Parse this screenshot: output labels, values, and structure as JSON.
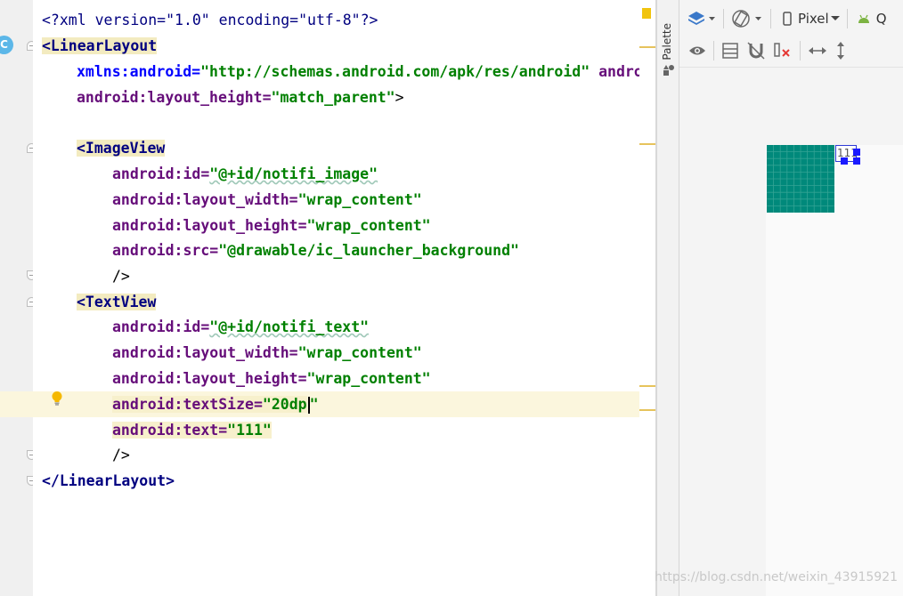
{
  "editor": {
    "lines": [
      {
        "parts": [
          {
            "c": "pi",
            "t": "<?xml version=\"1.0\" encoding=\"utf-8\"?>"
          }
        ]
      },
      {
        "parts": [
          {
            "c": "tag",
            "t": "<LinearLayout"
          }
        ]
      },
      {
        "parts": [
          {
            "c": "xmlns",
            "t": "xmlns:android="
          },
          {
            "c": "str",
            "t": "\"http://schemas.android.com/apk/res/android\""
          },
          {
            "c": "attr",
            "t": " androi"
          }
        ]
      },
      {
        "parts": [
          {
            "c": "attr",
            "t": "android:layout_height="
          },
          {
            "c": "str",
            "t": "\"match_parent\""
          },
          {
            "c": "punct",
            "t": ">"
          }
        ]
      },
      {
        "parts": []
      },
      {
        "parts": [
          {
            "c": "tag",
            "t": "<ImageView"
          }
        ]
      },
      {
        "parts": [
          {
            "c": "attr",
            "t": "android:id="
          },
          {
            "c": "str",
            "t": "\"@+id/notifi_image\""
          }
        ]
      },
      {
        "parts": [
          {
            "c": "attr",
            "t": "android:layout_width="
          },
          {
            "c": "str",
            "t": "\"wrap_content\""
          }
        ]
      },
      {
        "parts": [
          {
            "c": "attr",
            "t": "android:layout_height="
          },
          {
            "c": "str",
            "t": "\"wrap_content\""
          }
        ]
      },
      {
        "parts": [
          {
            "c": "attr",
            "t": "android:src="
          },
          {
            "c": "str",
            "t": "\"@drawable/ic_launcher_background\""
          }
        ]
      },
      {
        "parts": [
          {
            "c": "punct",
            "t": "/>"
          }
        ]
      },
      {
        "parts": [
          {
            "c": "tag",
            "t": "<TextView"
          }
        ]
      },
      {
        "parts": [
          {
            "c": "attr",
            "t": "android:id="
          },
          {
            "c": "str",
            "t": "\"@+id/notifi_text\""
          }
        ]
      },
      {
        "parts": [
          {
            "c": "attr",
            "t": "android:layout_width="
          },
          {
            "c": "str",
            "t": "\"wrap_content\""
          }
        ]
      },
      {
        "parts": [
          {
            "c": "attr",
            "t": "android:layout_height="
          },
          {
            "c": "str",
            "t": "\"wrap_content\""
          }
        ]
      },
      {
        "parts": [
          {
            "c": "attr",
            "t": "android:textSize="
          },
          {
            "c": "str",
            "t": "\"20dp\""
          }
        ]
      },
      {
        "parts": [
          {
            "c": "attr",
            "t": "android:text="
          },
          {
            "c": "str",
            "t": "\"111\""
          }
        ]
      },
      {
        "parts": [
          {
            "c": "punct",
            "t": "/>"
          }
        ]
      },
      {
        "parts": [
          {
            "c": "tag",
            "t": "</LinearLayout>"
          }
        ]
      }
    ],
    "current_line": 15,
    "gutter_badge": "C"
  },
  "palette": {
    "label": "Palette"
  },
  "design": {
    "device_label": "Pixel",
    "api_label": "Q",
    "preview_text": "111",
    "image_color": "#00897b"
  },
  "watermark": "https://blog.csdn.net/weixin_43915921"
}
